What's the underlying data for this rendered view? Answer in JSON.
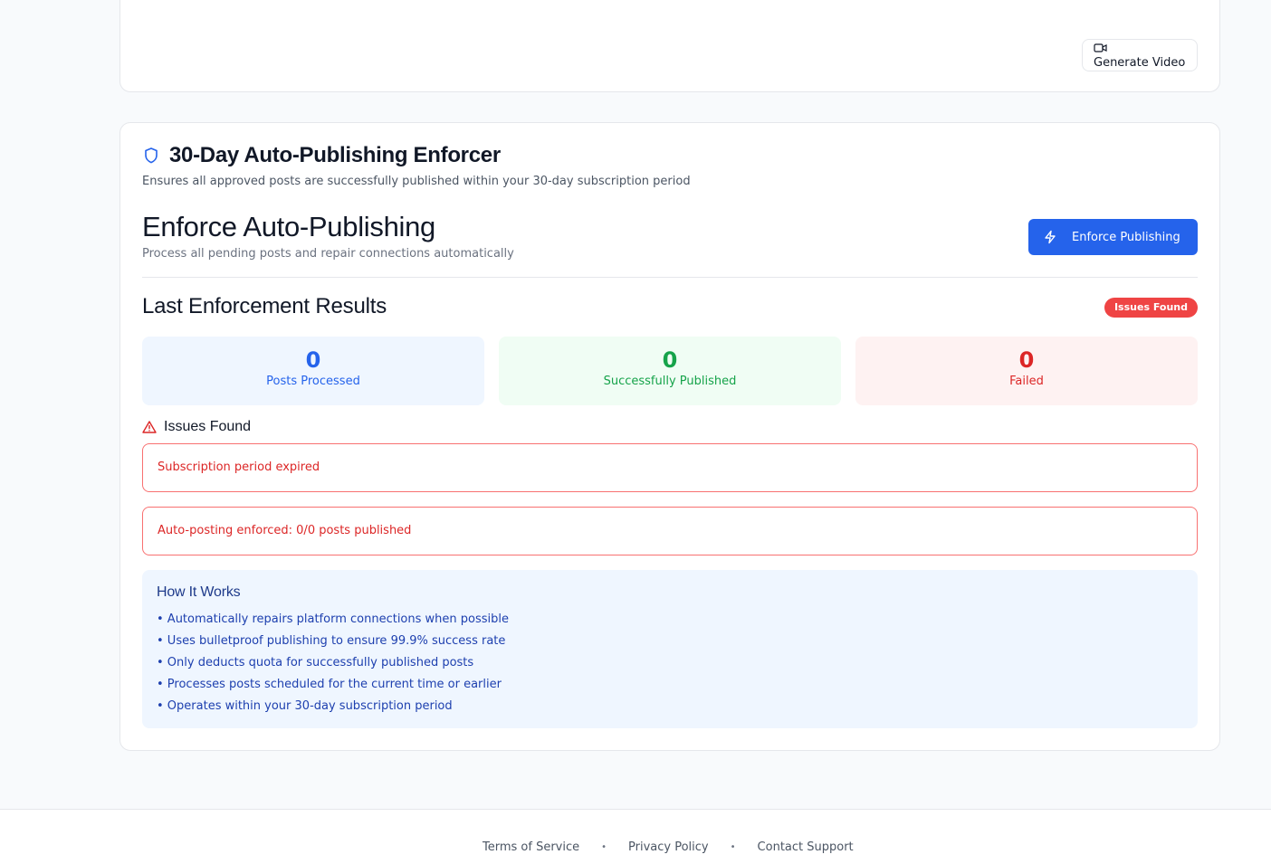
{
  "top_card": {
    "generate_video_label": "Generate Video"
  },
  "enforcer": {
    "title": "30-Day Auto-Publishing Enforcer",
    "subtitle": "Ensures all approved posts are successfully published within your 30-day subscription period",
    "action_title": "Enforce Auto-Publishing",
    "action_subtitle": "Process all pending posts and repair connections automatically",
    "enforce_button_label": "Enforce Publishing",
    "results_title": "Last Enforcement Results",
    "status_badge": "Issues Found",
    "stats": [
      {
        "value": "0",
        "label": "Posts Processed",
        "color": "#2563eb"
      },
      {
        "value": "0",
        "label": "Successfully Published",
        "color": "#16a34a"
      },
      {
        "value": "0",
        "label": "Failed",
        "color": "#dc2626"
      }
    ],
    "issues_heading": "Issues Found",
    "issues": [
      "Subscription period expired",
      "Auto-posting enforced: 0/0 posts published"
    ],
    "how_it_works": {
      "title": "How It Works",
      "items": [
        "• Automatically repairs platform connections when possible",
        "• Uses bulletproof publishing to ensure 99.9% success rate",
        "• Only deducts quota for successfully published posts",
        "• Processes posts scheduled for the current time or earlier",
        "• Operates within your 30-day subscription period"
      ]
    }
  },
  "footer": {
    "links": [
      "Terms of Service",
      "Privacy Policy",
      "Contact Support"
    ],
    "separator": "•"
  },
  "colors": {
    "primary": "#2563eb",
    "danger": "#ef4444",
    "success": "#16a34a"
  }
}
